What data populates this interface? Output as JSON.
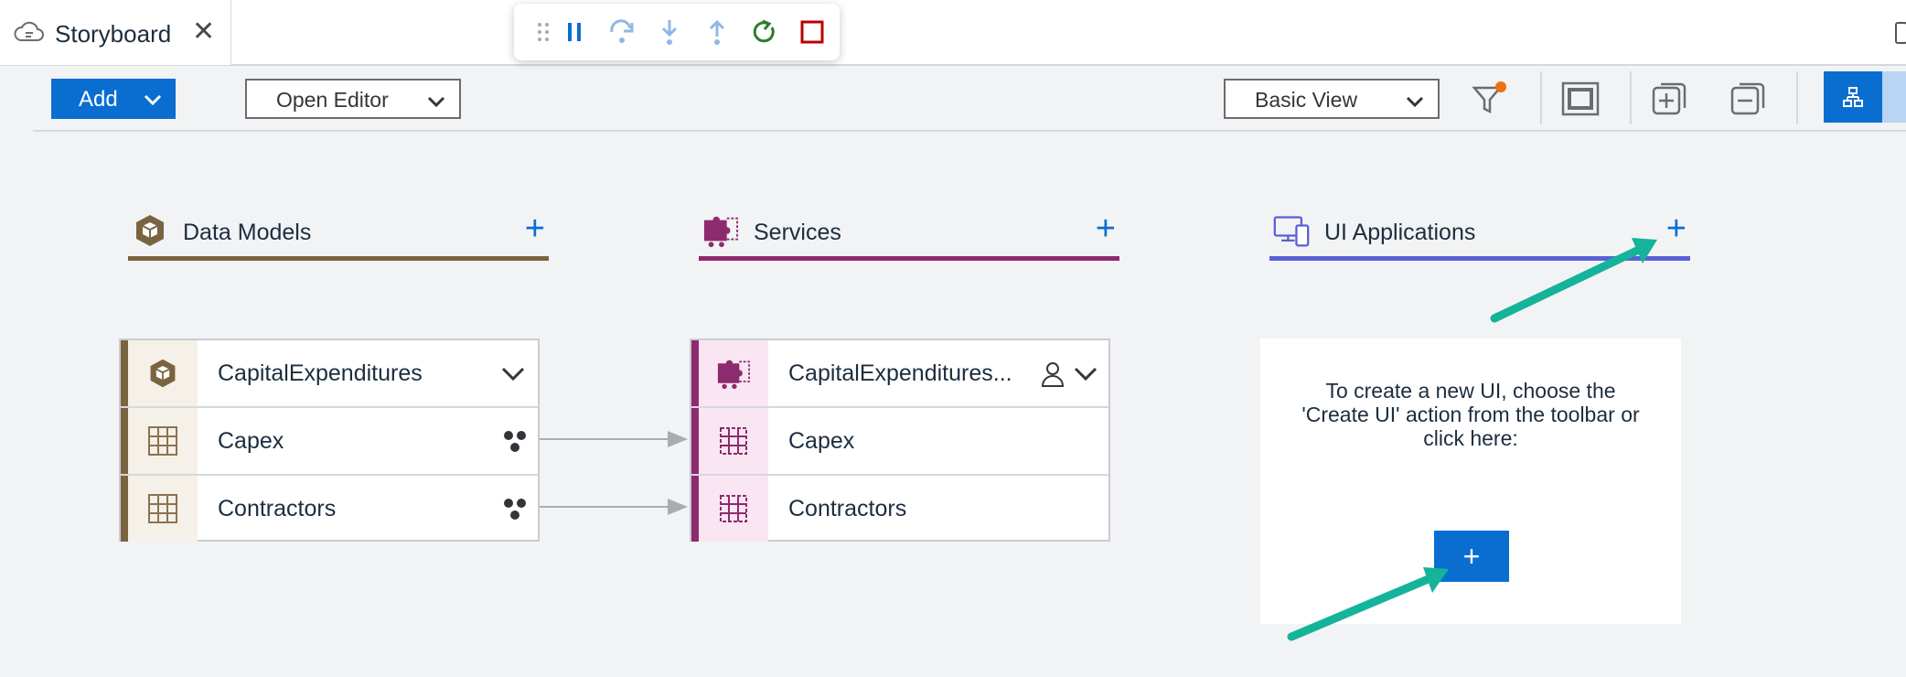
{
  "tab": {
    "title": "Storyboard",
    "close_label": "✕",
    "icon": "cloud-storyboard-icon"
  },
  "debug_toolbar": {
    "items": [
      "drag-handle-icon",
      "pause-icon",
      "step-over-icon",
      "step-into-icon",
      "step-out-icon",
      "restart-icon",
      "stop-icon"
    ],
    "colors": {
      "active": "#0a6ed1",
      "disabled": "#8fb8e6",
      "restart": "#2b7d2b",
      "stop": "#bb0000"
    }
  },
  "toolbar": {
    "add_label": "Add",
    "open_editor_label": "Open Editor",
    "view_select_label": "Basic View",
    "icons": [
      "filter-icon",
      "fit-to-screen-icon",
      "expand-all-icon",
      "collapse-all-icon",
      "diagram-view-icon"
    ]
  },
  "columns": {
    "data_models": {
      "title": "Data Models",
      "add_label": "+",
      "accent": "#7a6440",
      "rows": [
        {
          "name": "CapitalExpenditures",
          "icon": "cube-icon",
          "trail": "chevron-down-icon"
        },
        {
          "name": "Capex",
          "icon": "table-grid-icon",
          "trail": "associations-icon"
        },
        {
          "name": "Contractors",
          "icon": "table-grid-icon",
          "trail": "associations-icon"
        }
      ]
    },
    "services": {
      "title": "Services",
      "add_label": "+",
      "accent": "#8e2a6f",
      "rows": [
        {
          "name": "CapitalExpenditures...",
          "icon": "puzzle-icon",
          "trail": "chevron-down-icon",
          "extra": "user-icon"
        },
        {
          "name": "Capex",
          "icon": "entity-set-icon"
        },
        {
          "name": "Contractors",
          "icon": "entity-set-icon"
        }
      ]
    },
    "ui_applications": {
      "title": "UI Applications",
      "add_label": "+",
      "accent": "#5b5fd6",
      "empty_message": "To create a new UI, choose the 'Create UI' action from the toolbar or click here:",
      "create_label": "+"
    }
  },
  "annotation_color": "#14b39a"
}
